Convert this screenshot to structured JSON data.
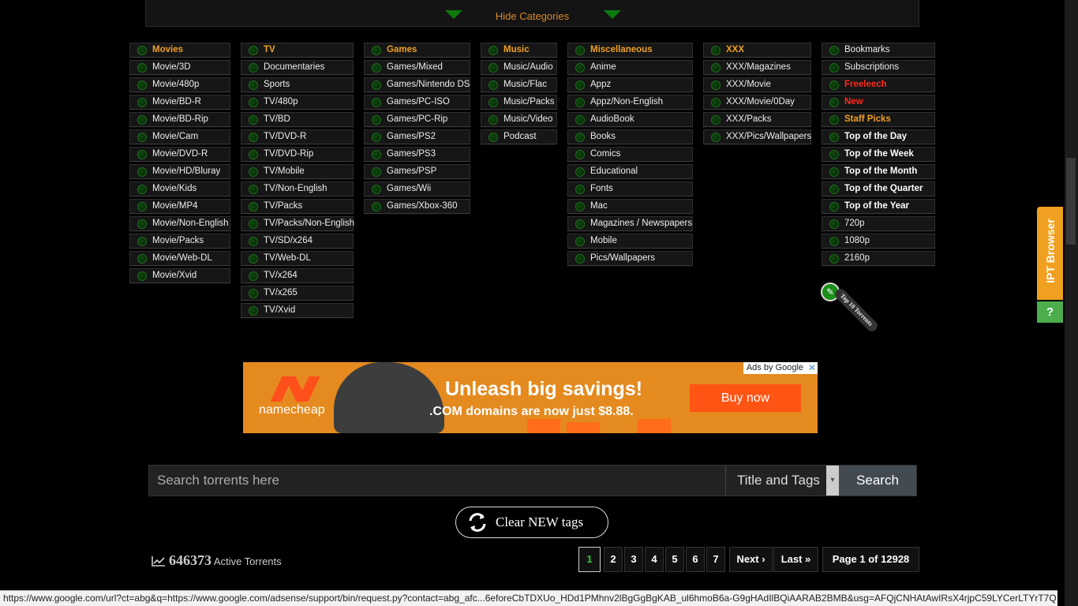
{
  "topbar": {
    "hide_label": "Hide Categories"
  },
  "columns": [
    {
      "items": [
        {
          "label": "Movies",
          "style": "head"
        },
        {
          "label": "Movie/3D"
        },
        {
          "label": "Movie/480p"
        },
        {
          "label": "Movie/BD-R"
        },
        {
          "label": "Movie/BD-Rip"
        },
        {
          "label": "Movie/Cam"
        },
        {
          "label": "Movie/DVD-R"
        },
        {
          "label": "Movie/HD/Bluray"
        },
        {
          "label": "Movie/Kids"
        },
        {
          "label": "Movie/MP4"
        },
        {
          "label": "Movie/Non-English"
        },
        {
          "label": "Movie/Packs"
        },
        {
          "label": "Movie/Web-DL"
        },
        {
          "label": "Movie/Xvid"
        }
      ]
    },
    {
      "items": [
        {
          "label": "TV",
          "style": "head"
        },
        {
          "label": "Documentaries"
        },
        {
          "label": "Sports"
        },
        {
          "label": "TV/480p"
        },
        {
          "label": "TV/BD"
        },
        {
          "label": "TV/DVD-R"
        },
        {
          "label": "TV/DVD-Rip"
        },
        {
          "label": "TV/Mobile"
        },
        {
          "label": "TV/Non-English"
        },
        {
          "label": "TV/Packs"
        },
        {
          "label": "TV/Packs/Non-English"
        },
        {
          "label": "TV/SD/x264"
        },
        {
          "label": "TV/Web-DL"
        },
        {
          "label": "TV/x264"
        },
        {
          "label": "TV/x265"
        },
        {
          "label": "TV/Xvid"
        }
      ]
    },
    {
      "items": [
        {
          "label": "Games",
          "style": "head"
        },
        {
          "label": "Games/Mixed"
        },
        {
          "label": "Games/Nintendo DS"
        },
        {
          "label": "Games/PC-ISO"
        },
        {
          "label": "Games/PC-Rip"
        },
        {
          "label": "Games/PS2"
        },
        {
          "label": "Games/PS3"
        },
        {
          "label": "Games/PSP"
        },
        {
          "label": "Games/Wii"
        },
        {
          "label": "Games/Xbox-360"
        }
      ]
    },
    {
      "items": [
        {
          "label": "Music",
          "style": "head"
        },
        {
          "label": "Music/Audio"
        },
        {
          "label": "Music/Flac"
        },
        {
          "label": "Music/Packs"
        },
        {
          "label": "Music/Video"
        },
        {
          "label": "Podcast"
        }
      ]
    },
    {
      "items": [
        {
          "label": "Miscellaneous",
          "style": "head"
        },
        {
          "label": "Anime"
        },
        {
          "label": "Appz"
        },
        {
          "label": "Appz/Non-English"
        },
        {
          "label": "AudioBook"
        },
        {
          "label": "Books"
        },
        {
          "label": "Comics"
        },
        {
          "label": "Educational"
        },
        {
          "label": "Fonts"
        },
        {
          "label": "Mac"
        },
        {
          "label": "Magazines / Newspapers"
        },
        {
          "label": "Mobile"
        },
        {
          "label": "Pics/Wallpapers"
        }
      ]
    },
    {
      "items": [
        {
          "label": "XXX",
          "style": "head"
        },
        {
          "label": "XXX/Magazines"
        },
        {
          "label": "XXX/Movie"
        },
        {
          "label": "XXX/Movie/0Day"
        },
        {
          "label": "XXX/Packs"
        },
        {
          "label": "XXX/Pics/Wallpapers"
        }
      ]
    },
    {
      "items": [
        {
          "label": "Bookmarks"
        },
        {
          "label": "Subscriptions"
        },
        {
          "label": "Freeleech",
          "style": "red"
        },
        {
          "label": "New",
          "style": "red"
        },
        {
          "label": "Staff Picks",
          "style": "orange"
        },
        {
          "label": "Top of the Day",
          "style": "bold"
        },
        {
          "label": "Top of the Week",
          "style": "bold"
        },
        {
          "label": "Top of the Month",
          "style": "bold"
        },
        {
          "label": "Top of the Quarter",
          "style": "bold"
        },
        {
          "label": "Top of the Year",
          "style": "bold"
        },
        {
          "label": "720p"
        },
        {
          "label": "1080p"
        },
        {
          "label": "2160p"
        }
      ]
    }
  ],
  "badge": {
    "text": "Top 10 Torrents"
  },
  "ad": {
    "brand": "namecheap",
    "headline": "Unleash big savings!",
    "subline": ".COM domains are now just $8.88.",
    "cta": "Buy now",
    "ads_by": "Ads by Google",
    "brand_color": "#e58a1f"
  },
  "search": {
    "placeholder": "Search torrents here",
    "mode": "Title and Tags",
    "button": "Search"
  },
  "clear_tags": {
    "label": "Clear NEW tags"
  },
  "stats": {
    "count": "646373",
    "label": "Active Torrents"
  },
  "pagination": {
    "pages": [
      "1",
      "2",
      "3",
      "4",
      "5",
      "6",
      "7"
    ],
    "active": "1",
    "next": "Next ›",
    "last": "Last »",
    "summary": "Page 1 of 12928"
  },
  "sidebar_widget": {
    "label": "IPT Browser",
    "help": "?"
  },
  "status_url": "https://www.google.com/url?ct=abg&q=https://www.google.com/adsense/support/bin/request.py?contact=abg_afc...6eforeCbTDXUo_HDd1PMhnv2lBgGgBgKAB_ul6hmoB6a-G9gHAdIlBQiAARAB2BMB&usg=AFQjCNHAtAwIRsX4rjpC59LYCerLTYrT7Q"
}
